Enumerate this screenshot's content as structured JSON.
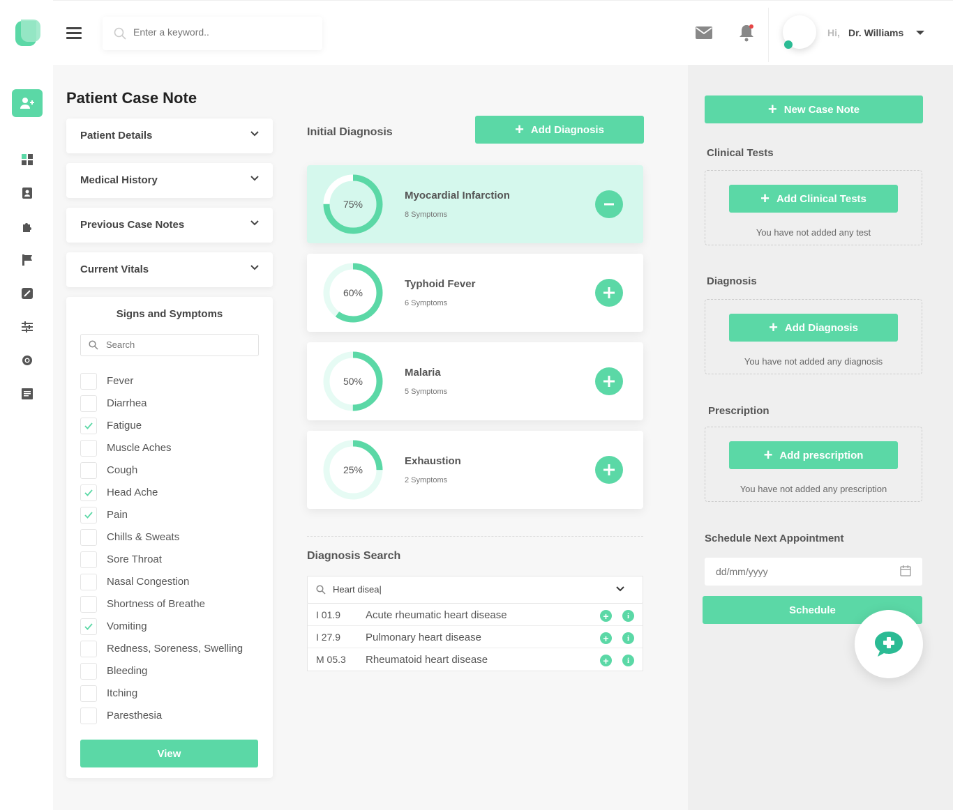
{
  "header": {
    "search_placeholder": "Enter a keyword..",
    "greeting": "Hi,",
    "user_name": "Dr. Williams"
  },
  "page": {
    "title": "Patient Case Note"
  },
  "accordions": [
    {
      "label": "Patient Details"
    },
    {
      "label": "Medical History"
    },
    {
      "label": "Previous Case Notes"
    },
    {
      "label": "Current Vitals"
    }
  ],
  "symptoms": {
    "title": "Signs and Symptoms",
    "search_placeholder": "Search",
    "items": [
      {
        "label": "Fever",
        "checked": false
      },
      {
        "label": "Diarrhea",
        "checked": false
      },
      {
        "label": "Fatigue",
        "checked": true
      },
      {
        "label": "Muscle Aches",
        "checked": false
      },
      {
        "label": "Cough",
        "checked": false
      },
      {
        "label": "Head Ache",
        "checked": true
      },
      {
        "label": "Pain",
        "checked": true
      },
      {
        "label": "Chills & Sweats",
        "checked": false
      },
      {
        "label": "Sore Throat",
        "checked": false
      },
      {
        "label": "Nasal Congestion",
        "checked": false
      },
      {
        "label": "Shortness of Breathe",
        "checked": false
      },
      {
        "label": "Vomiting",
        "checked": true
      },
      {
        "label": "Redness, Soreness, Swelling",
        "checked": false
      },
      {
        "label": "Bleeding",
        "checked": false
      },
      {
        "label": "Itching",
        "checked": false
      },
      {
        "label": "Paresthesia",
        "checked": false
      }
    ],
    "view_label": "View"
  },
  "initial_diagnosis": {
    "title": "Initial Diagnosis",
    "add_label": "Add Diagnosis",
    "items": [
      {
        "name": "Myocardial Infarction",
        "symptoms": "8 Symptoms",
        "percent": 75,
        "percent_label": "75%",
        "selected": true
      },
      {
        "name": "Typhoid Fever",
        "symptoms": "6 Symptoms",
        "percent": 60,
        "percent_label": "60%",
        "selected": false
      },
      {
        "name": "Malaria",
        "symptoms": "5 Symptoms",
        "percent": 50,
        "percent_label": "50%",
        "selected": false
      },
      {
        "name": "Exhaustion",
        "symptoms": "2 Symptoms",
        "percent": 25,
        "percent_label": "25%",
        "selected": false
      }
    ]
  },
  "diagnosis_search": {
    "title": "Diagnosis Search",
    "query": "Heart disea|",
    "results": [
      {
        "code": "I 01.9",
        "name": "Acute rheumatic heart disease"
      },
      {
        "code": "I 27.9",
        "name": "Pulmonary heart disease"
      },
      {
        "code": "M 05.3",
        "name": "Rheumatoid heart disease"
      }
    ]
  },
  "right_panel": {
    "new_case_note_label": "New Case Note",
    "clinical_tests": {
      "title": "Clinical Tests",
      "button": "Add Clinical Tests",
      "empty": "You have not added any test"
    },
    "diagnosis": {
      "title": "Diagnosis",
      "button": "Add Diagnosis",
      "empty": "You have not added any diagnosis"
    },
    "prescription": {
      "title": "Prescription",
      "button": "Add prescription",
      "empty": "You have not added any prescription"
    },
    "schedule": {
      "title": "Schedule Next Appointment",
      "date_placeholder": "dd/mm/yyyy",
      "button": "Schedule"
    }
  },
  "colors": {
    "accent": "#5bd8a6",
    "accent_light": "#d5f8ed",
    "ring_track": "#e6fbf4"
  }
}
